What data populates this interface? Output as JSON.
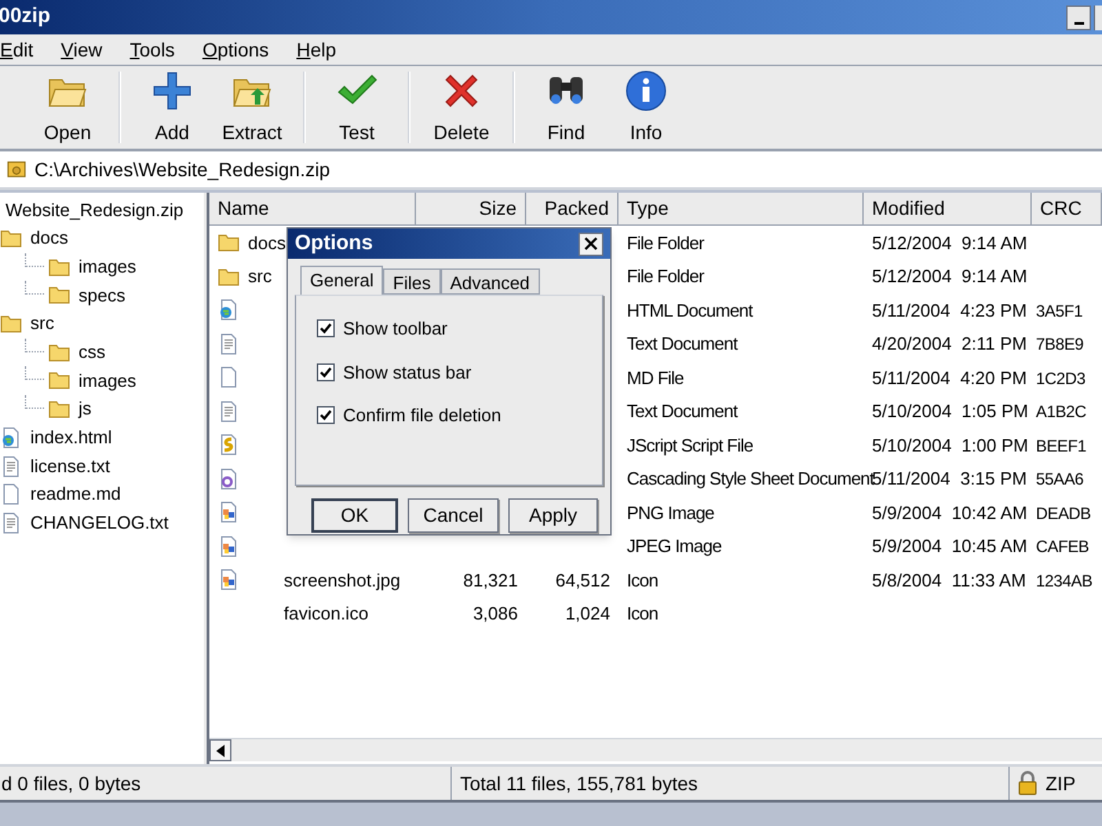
{
  "window": {
    "title": "00zip"
  },
  "menu": [
    "Edit",
    "View",
    "Tools",
    "Options",
    "Help"
  ],
  "toolbar": [
    {
      "label": "Open",
      "separator_before": false
    },
    {
      "label": "Add",
      "separator_before": true
    },
    {
      "label": "Extract",
      "separator_before": false
    },
    {
      "label": "Test",
      "separator_before": true
    },
    {
      "label": "Delete",
      "separator_before": true
    },
    {
      "label": "Find",
      "separator_before": true
    },
    {
      "label": "Info",
      "separator_before": false
    }
  ],
  "address": {
    "value": "C:\\Archives\\Website_Redesign.zip"
  },
  "tree": [
    {
      "label": "Website_Redesign.zip",
      "kind": "root"
    },
    {
      "label": "docs",
      "kind": "folder",
      "children": [
        {
          "label": "images",
          "kind": "folder"
        },
        {
          "label": "specs",
          "kind": "folder"
        }
      ]
    },
    {
      "label": "src",
      "kind": "folder",
      "children": [
        {
          "label": "css",
          "kind": "folder"
        },
        {
          "label": "images",
          "kind": "folder"
        },
        {
          "label": "js",
          "kind": "folder"
        }
      ]
    },
    {
      "label": "index.html",
      "kind": "html"
    },
    {
      "label": "license.txt",
      "kind": "text"
    },
    {
      "label": "readme.md",
      "kind": "blank"
    },
    {
      "label": "CHANGELOG.txt",
      "kind": "text"
    }
  ],
  "table": {
    "columns": [
      "Name",
      "Size",
      "Packed",
      "Type",
      "Modified",
      "CRC"
    ],
    "rows": [
      {
        "kind": "folder",
        "name": "docs",
        "type": "File Folder",
        "modified": "5/12/2004  9:14 AM"
      },
      {
        "kind": "folder",
        "name": "src",
        "type": "File Folder",
        "modified": "5/12/2004  9:14 AM"
      },
      {
        "kind": "html",
        "type": "HTML Document",
        "modified": "5/11/2004  4:23 PM",
        "crc": "3A5F1"
      },
      {
        "kind": "text",
        "type": "Text Document",
        "modified": "4/20/2004  2:11 PM",
        "crc": "7B8E9"
      },
      {
        "kind": "blank",
        "type": "MD File",
        "modified": "5/11/2004  4:20 PM",
        "crc": "1C2D3"
      },
      {
        "kind": "text",
        "type": "Text Document",
        "modified": "5/10/2004  1:05 PM",
        "crc": "A1B2C"
      },
      {
        "kind": "script",
        "type": "JScript Script File",
        "modified": "5/10/2004  1:00 PM",
        "crc": "BEEF1"
      },
      {
        "kind": "css",
        "type": "Cascading Style Sheet Document",
        "modified": "5/11/2004  3:15 PM",
        "crc": "55AA6"
      },
      {
        "kind": "image",
        "type": "PNG Image",
        "modified": "5/9/2004  10:42 AM",
        "crc": "DEADB"
      },
      {
        "kind": "image",
        "type": "JPEG Image",
        "modified": "5/9/2004  10:45 AM",
        "crc": "CAFEB"
      },
      {
        "kind": "image",
        "name": "screenshot.jpg",
        "size": "81,321",
        "packed": "64,512",
        "type": "Icon",
        "modified": "5/8/2004  11:33 AM",
        "crc": "1234AB"
      },
      {
        "kind": "none",
        "name": "favicon.ico",
        "size": "3,086",
        "packed": "1,024",
        "type": "Icon"
      }
    ]
  },
  "dialog": {
    "title": "Options",
    "tabs": [
      {
        "label": "General",
        "selected": true
      },
      {
        "label": "Files",
        "selected": false
      },
      {
        "label": "Advanced",
        "selected": false
      }
    ],
    "options": [
      {
        "label": "Show toolbar",
        "checked": true
      },
      {
        "label": "Show status bar",
        "checked": true
      },
      {
        "label": "Confirm file deletion",
        "checked": true
      }
    ],
    "buttons": [
      {
        "label": "OK",
        "default": true
      },
      {
        "label": "Cancel",
        "default": false
      },
      {
        "label": "Apply",
        "default": false
      }
    ]
  },
  "status_bar": {
    "selected": "d 0 files, 0 bytes",
    "total": "Total 11 files, 155,781 bytes",
    "format": "ZIP"
  }
}
